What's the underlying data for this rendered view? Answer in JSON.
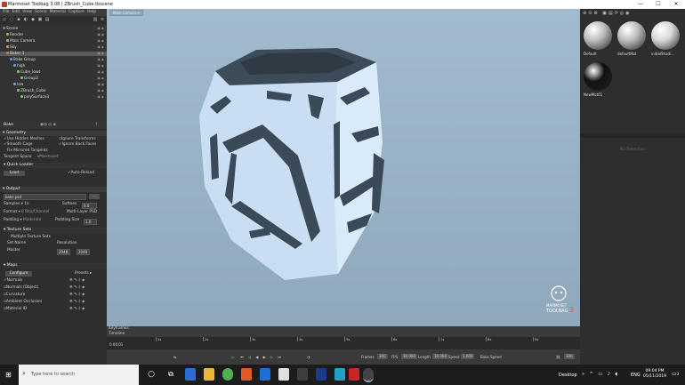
{
  "window": {
    "title": "Marmoset Toolbag 3.08 | ZBrush_Cube.tbscene",
    "min": "—",
    "max": "☐",
    "close": "✕"
  },
  "menu": [
    "File",
    "Edit",
    "View",
    "Scene",
    "Material",
    "Capture",
    "Help"
  ],
  "scene_tree": [
    {
      "label": "Scene",
      "depth": 0,
      "color": "#7a7a7a"
    },
    {
      "label": "Render",
      "depth": 1,
      "color": "#c8a040"
    },
    {
      "label": "Main Camera",
      "depth": 1,
      "color": "#9aa0a8"
    },
    {
      "label": "Sky",
      "depth": 1,
      "color": "#c8a040"
    },
    {
      "label": "Baker 1",
      "depth": 1,
      "color": "#c87840",
      "selected": true
    },
    {
      "label": "Bake Group",
      "depth": 2,
      "color": "#6a9ad0"
    },
    {
      "label": "high",
      "depth": 3,
      "color": "#6a9ad0"
    },
    {
      "label": "Cube_lowt",
      "depth": 4,
      "color": "#7ac070"
    },
    {
      "label": "Group2",
      "depth": 5,
      "color": "#7ac070"
    },
    {
      "label": "low",
      "depth": 3,
      "color": "#6a9ad0"
    },
    {
      "label": "ZBrush_Cube",
      "depth": 4,
      "color": "#7ac070"
    },
    {
      "label": "polySurface3",
      "depth": 5,
      "color": "#7ac070"
    }
  ],
  "props": {
    "header": "Bake",
    "geometry_section": "Geometry",
    "use_hidden_meshes": "Use Hidden Meshes",
    "ignore_transforms": "Ignore Transforms",
    "smooth_cage": "Smooth Cage",
    "ignore_back_faces": "Ignore Back Faces",
    "fix_mirrored_tangents": "Fix Mirrored Tangents",
    "tangent_space_label": "Tangent Space",
    "tangent_space_value": "Marmoset",
    "quick_loader": "Quick Loader",
    "load": "Load",
    "auto_reload": "Auto-Reload",
    "output_section": "Output",
    "output_file": "bake.psd",
    "samples_label": "Samples",
    "samples_value": "1x",
    "softness_label": "Softnes",
    "softness_value": "0.0",
    "format_label": "Format",
    "format_value": "8 Bits/Channel",
    "multi_layer": "Multi-Layer PSD",
    "padding_label": "Padding",
    "padding_value": "Moderate",
    "padding_size_label": "Padding Size",
    "padding_size_value": "1.0",
    "texture_sets_section": "Texture Sets",
    "multiple_texture_sets": "Multiple Texture Sets",
    "set_name_label": "Set Name",
    "resolution_label": "Resolution",
    "master_label": "Master",
    "res_w": "2048",
    "res_h": "2048",
    "maps_section": "Maps",
    "configure": "Configure",
    "presets": "Presets",
    "maps": [
      "Normals",
      "Normals (Object)",
      "Curvature",
      "Ambient Occlusion",
      "Material ID"
    ]
  },
  "viewport": {
    "camera_dropdown": "Main Camera",
    "logo_line1": "MARMOSET",
    "logo_line2": "TOOLBAG",
    "logo_num": "3"
  },
  "materials": [
    {
      "name": "Default",
      "color": "#bdbdbd"
    },
    {
      "name": "defaultMat",
      "color": "#bdbdbd"
    },
    {
      "name": "initialShadi...",
      "color": "#d8d8d8"
    },
    {
      "name": "NewMat01",
      "color": "#111111"
    }
  ],
  "right_panel": {
    "no_selection": "No Selection"
  },
  "timeline": {
    "keyframes_label": "Keyframes",
    "timeline_label": "Timeline",
    "time": "0:00.01",
    "ticks": [
      "1s",
      "2s",
      "3s",
      "4s",
      "5s",
      "6s",
      "7s",
      "8s",
      "9s"
    ],
    "frames_label": "Frames",
    "frames_value": "300",
    "fps_label": "FPS",
    "fps_value": "30.000",
    "length_label": "Length",
    "length_value": "10.000",
    "speed_label": "Speed",
    "speed_value": "1.000",
    "bake_speed": "Bake Speed",
    "end_value": "300"
  },
  "taskbar": {
    "search_placeholder": "Type here to search",
    "desktop": "Desktop",
    "lang": "ENG",
    "time": "09:04 PM",
    "date": "05/11/2019",
    "notif_count": "3"
  },
  "colors": {
    "viewport_top": "#a1bace",
    "cube_light": "#cfe3f5",
    "cube_dark": "#3b4a58",
    "accent": "#c0392b"
  }
}
